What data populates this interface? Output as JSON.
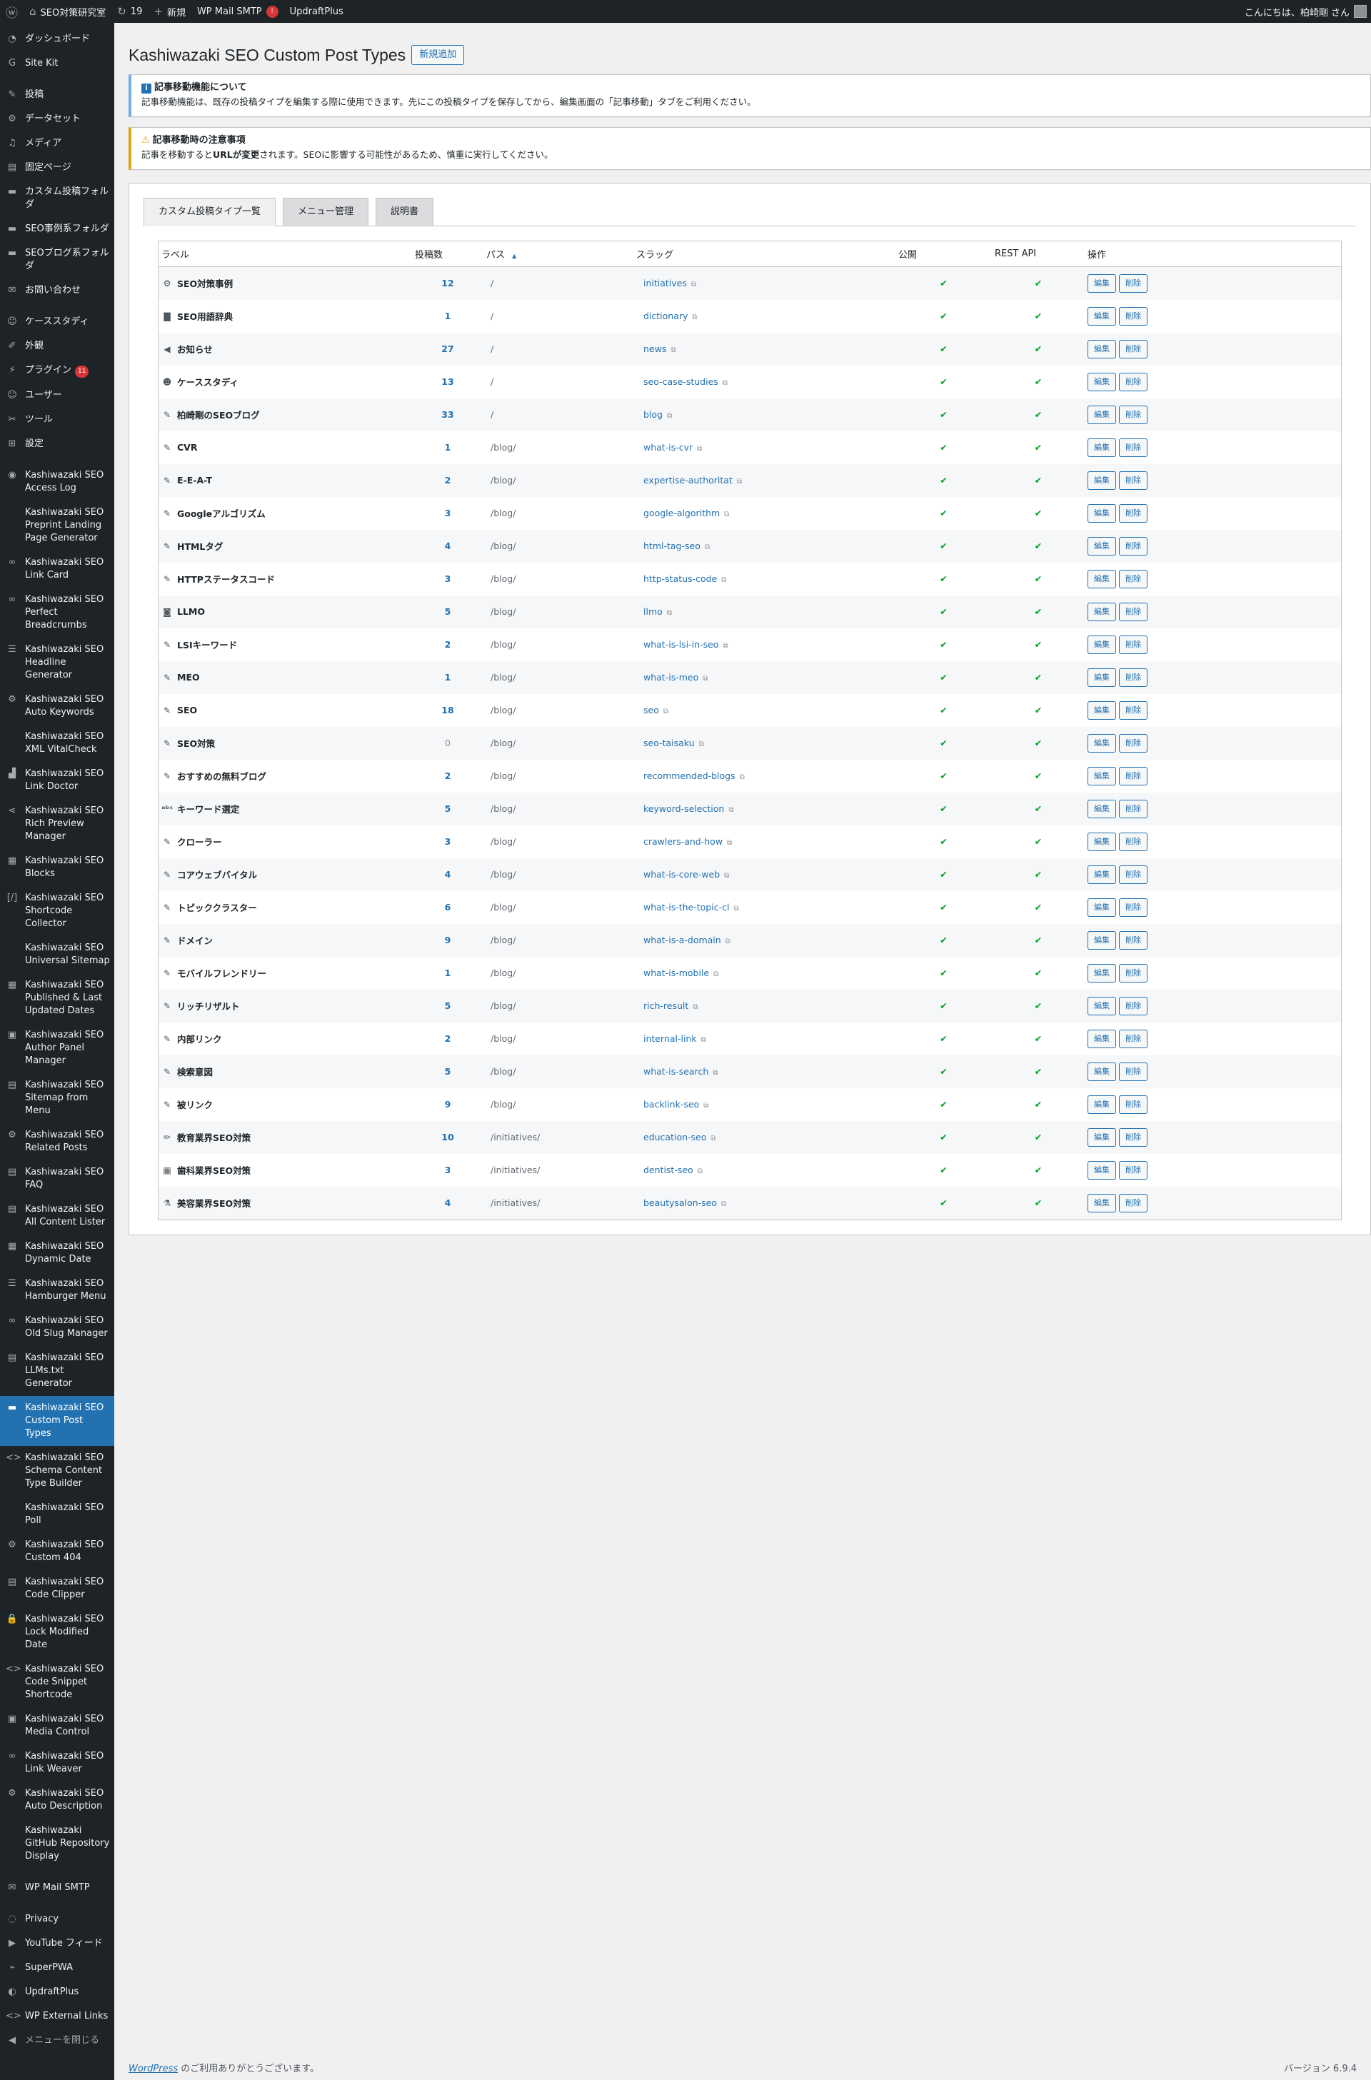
{
  "adminbar": {
    "site_name": "SEO対策研究室",
    "updates_count": "19",
    "new_label": "新規",
    "smtp_label": "WP Mail SMTP",
    "smtp_badge": "!",
    "updraft_label": "UpdraftPlus",
    "greeting": "こんにちは、柏崎剛 さん"
  },
  "sidebar": {
    "items": [
      {
        "label": "ダッシュボード",
        "icon": "dashboard-icon",
        "glyph": "◔"
      },
      {
        "label": "Site Kit",
        "icon": "sitekit-icon",
        "glyph": "G"
      },
      {
        "label": "投稿",
        "icon": "pin-icon",
        "glyph": "✎"
      },
      {
        "label": "データセット",
        "icon": "gear-icon",
        "glyph": "⚙"
      },
      {
        "label": "メディア",
        "icon": "media-icon",
        "glyph": "♫"
      },
      {
        "label": "固定ページ",
        "icon": "page-icon",
        "glyph": "▤"
      },
      {
        "label": "カスタム投稿フォルダ",
        "icon": "folder-icon",
        "glyph": "▬"
      },
      {
        "label": "SEO事例系フォルダ",
        "icon": "folder-icon",
        "glyph": "▬"
      },
      {
        "label": "SEOブログ系フォルダ",
        "icon": "folder-icon",
        "glyph": "▬"
      },
      {
        "label": "お問い合わせ",
        "icon": "mail-icon",
        "glyph": "✉"
      },
      {
        "label": "ケーススタディ",
        "icon": "user-icon",
        "glyph": "☺"
      },
      {
        "label": "外観",
        "icon": "brush-icon",
        "glyph": "✐"
      },
      {
        "label": "プラグイン",
        "icon": "plugin-icon",
        "glyph": "⚡",
        "badge": "11"
      },
      {
        "label": "ユーザー",
        "icon": "user-icon",
        "glyph": "☺"
      },
      {
        "label": "ツール",
        "icon": "wrench-icon",
        "glyph": "✂"
      },
      {
        "label": "設定",
        "icon": "settings-icon",
        "glyph": "⊞"
      },
      {
        "label": "Kashiwazaki SEO Access Log",
        "icon": "eye-icon",
        "glyph": "◉"
      },
      {
        "label": "Kashiwazaki SEO Preprint Landing Page Generator",
        "icon": "doc-icon",
        "glyph": ""
      },
      {
        "label": "Kashiwazaki SEO Link Card",
        "icon": "link-icon",
        "glyph": "∞"
      },
      {
        "label": "Kashiwazaki SEO Perfect Breadcrumbs",
        "icon": "link-icon",
        "glyph": "∞"
      },
      {
        "label": "Kashiwazaki SEO Headline Generator",
        "icon": "list-icon",
        "glyph": "☰"
      },
      {
        "label": "Kashiwazaki SEO Auto Keywords",
        "icon": "gear-icon",
        "glyph": "⚙"
      },
      {
        "label": "Kashiwazaki SEO XML VitalCheck",
        "icon": "doc-icon",
        "glyph": ""
      },
      {
        "label": "Kashiwazaki SEO Link Doctor",
        "icon": "chart-icon",
        "glyph": "▟"
      },
      {
        "label": "Kashiwazaki SEO Rich Preview Manager",
        "icon": "share-icon",
        "glyph": "⋖"
      },
      {
        "label": "Kashiwazaki SEO Blocks",
        "icon": "blocks-icon",
        "glyph": "▦"
      },
      {
        "label": "Kashiwazaki SEO Shortcode Collector",
        "icon": "shortcode-icon",
        "glyph": "[/]"
      },
      {
        "label": "Kashiwazaki SEO Universal Sitemap",
        "icon": "doc-icon",
        "glyph": ""
      },
      {
        "label": "Kashiwazaki SEO Published & Last Updated Dates",
        "icon": "calendar-icon",
        "glyph": "▦"
      },
      {
        "label": "Kashiwazaki SEO Author Panel Manager",
        "icon": "id-icon",
        "glyph": "▣"
      },
      {
        "label": "Kashiwazaki SEO Sitemap from Menu",
        "icon": "list-icon",
        "glyph": "▤"
      },
      {
        "label": "Kashiwazaki SEO Related Posts",
        "icon": "gear-icon",
        "glyph": "⚙"
      },
      {
        "label": "Kashiwazaki SEO FAQ",
        "icon": "faq-icon",
        "glyph": "▤"
      },
      {
        "label": "Kashiwazaki SEO All Content Lister",
        "icon": "list-icon",
        "glyph": "▤"
      },
      {
        "label": "Kashiwazaki SEO Dynamic Date",
        "icon": "calendar-icon",
        "glyph": "▦"
      },
      {
        "label": "Kashiwazaki SEO Hamburger Menu",
        "icon": "menu-icon",
        "glyph": "☰"
      },
      {
        "label": "Kashiwazaki SEO Old Slug Manager",
        "icon": "link-icon",
        "glyph": "∞"
      },
      {
        "label": "Kashiwazaki SEO LLMs.txt Generator",
        "icon": "doc-icon",
        "glyph": "▤"
      },
      {
        "label": "Kashiwazaki SEO Custom Post Types",
        "icon": "archive-icon",
        "glyph": "▬",
        "active": true
      },
      {
        "label": "Kashiwazaki SEO Schema Content Type Builder",
        "icon": "code-icon",
        "glyph": "<>"
      },
      {
        "label": "Kashiwazaki SEO Poll",
        "icon": "doc-icon",
        "glyph": ""
      },
      {
        "label": "Kashiwazaki SEO Custom 404",
        "icon": "gear-icon",
        "glyph": "⚙"
      },
      {
        "label": "Kashiwazaki SEO Code Clipper",
        "icon": "clipboard-icon",
        "glyph": "▤"
      },
      {
        "label": "Kashiwazaki SEO Lock Modified Date",
        "icon": "lock-icon",
        "glyph": "🔒"
      },
      {
        "label": "Kashiwazaki SEO Code Snippet Shortcode",
        "icon": "code-icon",
        "glyph": "<>"
      },
      {
        "label": "Kashiwazaki SEO Media Control",
        "icon": "image-icon",
        "glyph": "▣"
      },
      {
        "label": "Kashiwazaki SEO Link Weaver",
        "icon": "link-icon",
        "glyph": "∞"
      },
      {
        "label": "Kashiwazaki SEO Auto Description",
        "icon": "gear-icon",
        "glyph": "⚙"
      },
      {
        "label": "Kashiwazaki GitHub Repository Display",
        "icon": "doc-icon",
        "glyph": ""
      },
      {
        "label": "WP Mail SMTP",
        "icon": "smtp-icon",
        "glyph": "✉"
      },
      {
        "label": "Privacy",
        "icon": "privacy-icon",
        "glyph": "◌"
      },
      {
        "label": "YouTube フィード",
        "icon": "youtube-icon",
        "glyph": "▶"
      },
      {
        "label": "SuperPWA",
        "icon": "pwa-icon",
        "glyph": "⌁"
      },
      {
        "label": "UpdraftPlus",
        "icon": "updraft-icon",
        "glyph": "◐"
      },
      {
        "label": "WP External Links",
        "icon": "external-links-icon",
        "glyph": "<>"
      },
      {
        "label": "メニューを閉じる",
        "icon": "collapse-icon",
        "glyph": "◀",
        "collapse": true
      }
    ]
  },
  "page": {
    "title": "Kashiwazaki SEO Custom Post Types",
    "add_new": "新規追加"
  },
  "notices": {
    "info_title": "記事移動機能について",
    "info_text": "記事移動機能は、既存の投稿タイプを編集する際に使用できます。先にこの投稿タイプを保存してから、編集画面の「記事移動」タブをご利用ください。",
    "warn_title": "記事移動時の注意事項",
    "warn_text_pre": "記事を移動すると",
    "warn_text_bold": "URLが変更",
    "warn_text_post": "されます。SEOに影響する可能性があるため、慎重に実行してください。"
  },
  "tabs": [
    "カスタム投稿タイプ一覧",
    "メニュー管理",
    "説明書"
  ],
  "table": {
    "headers": {
      "label": "ラベル",
      "count": "投稿数",
      "path": "パス",
      "sort_indicator": "▲",
      "slug": "スラッグ",
      "public": "公開",
      "rest": "REST API",
      "actions": "操作"
    },
    "edit_label": "編集",
    "delete_label": "削除",
    "check": "✔",
    "rows": [
      {
        "label": "SEO対策事例",
        "count": "12",
        "path": "/",
        "slug": "initiatives",
        "icon": "grid-icon",
        "glyph": "⚙"
      },
      {
        "label": "SEO用語辞典",
        "count": "1",
        "path": "/",
        "slug": "dictionary",
        "icon": "book-icon",
        "glyph": "▇"
      },
      {
        "label": "お知らせ",
        "count": "27",
        "path": "/",
        "slug": "news",
        "icon": "megaphone-icon",
        "glyph": "◀"
      },
      {
        "label": "ケーススタディ",
        "count": "13",
        "path": "/",
        "slug": "seo-case-studies",
        "icon": "user-icon",
        "glyph": "☻"
      },
      {
        "label": "柏崎剛のSEOブログ",
        "count": "33",
        "path": "/",
        "slug": "blog",
        "icon": "post-icon",
        "glyph": "✎"
      },
      {
        "label": "CVR",
        "count": "1",
        "path": "/blog/",
        "slug": "what-is-cvr",
        "icon": "post-icon",
        "glyph": "✎"
      },
      {
        "label": "E-E-A-T",
        "count": "2",
        "path": "/blog/",
        "slug": "expertise-authoritat",
        "icon": "post-icon",
        "glyph": "✎"
      },
      {
        "label": "Googleアルゴリズム",
        "count": "3",
        "path": "/blog/",
        "slug": "google-algorithm",
        "icon": "post-icon",
        "glyph": "✎"
      },
      {
        "label": "HTMLタグ",
        "count": "4",
        "path": "/blog/",
        "slug": "html-tag-seo",
        "icon": "post-icon",
        "glyph": "✎"
      },
      {
        "label": "HTTPステータスコード",
        "count": "3",
        "path": "/blog/",
        "slug": "http-status-code",
        "icon": "post-icon",
        "glyph": "✎"
      },
      {
        "label": "LLMO",
        "count": "5",
        "path": "/blog/",
        "slug": "llmo",
        "icon": "robot-icon",
        "glyph": "◙"
      },
      {
        "label": "LSIキーワード",
        "count": "2",
        "path": "/blog/",
        "slug": "what-is-lsi-in-seo",
        "icon": "post-icon",
        "glyph": "✎"
      },
      {
        "label": "MEO",
        "count": "1",
        "path": "/blog/",
        "slug": "what-is-meo",
        "icon": "post-icon",
        "glyph": "✎"
      },
      {
        "label": "SEO",
        "count": "18",
        "path": "/blog/",
        "slug": "seo",
        "icon": "post-icon",
        "glyph": "✎"
      },
      {
        "label": "SEO対策",
        "count": "0",
        "path": "/blog/",
        "slug": "seo-taisaku",
        "icon": "post-icon",
        "glyph": "✎"
      },
      {
        "label": "おすすめの無料ブログ",
        "count": "2",
        "path": "/blog/",
        "slug": "recommended-blogs",
        "icon": "post-icon",
        "glyph": "✎"
      },
      {
        "label": "キーワード選定",
        "count": "5",
        "path": "/blog/",
        "slug": "keyword-selection",
        "icon": "abc-icon",
        "glyph": "ᵃᵇᶜ"
      },
      {
        "label": "クローラー",
        "count": "3",
        "path": "/blog/",
        "slug": "crawlers-and-how",
        "icon": "post-icon",
        "glyph": "✎"
      },
      {
        "label": "コアウェブバイタル",
        "count": "4",
        "path": "/blog/",
        "slug": "what-is-core-web",
        "icon": "post-icon",
        "glyph": "✎"
      },
      {
        "label": "トピッククラスター",
        "count": "6",
        "path": "/blog/",
        "slug": "what-is-the-topic-cl",
        "icon": "post-icon",
        "glyph": "✎"
      },
      {
        "label": "ドメイン",
        "count": "9",
        "path": "/blog/",
        "slug": "what-is-a-domain",
        "icon": "post-icon",
        "glyph": "✎"
      },
      {
        "label": "モバイルフレンドリー",
        "count": "1",
        "path": "/blog/",
        "slug": "what-is-mobile",
        "icon": "post-icon",
        "glyph": "✎"
      },
      {
        "label": "リッチリザルト",
        "count": "5",
        "path": "/blog/",
        "slug": "rich-result",
        "icon": "post-icon",
        "glyph": "✎"
      },
      {
        "label": "内部リンク",
        "count": "2",
        "path": "/blog/",
        "slug": "internal-link",
        "icon": "post-icon",
        "glyph": "✎"
      },
      {
        "label": "検索意図",
        "count": "5",
        "path": "/blog/",
        "slug": "what-is-search",
        "icon": "post-icon",
        "glyph": "✎"
      },
      {
        "label": "被リンク",
        "count": "9",
        "path": "/blog/",
        "slug": "backlink-seo",
        "icon": "post-icon",
        "glyph": "✎"
      },
      {
        "label": "教育業界SEO対策",
        "count": "10",
        "path": "/initiatives/",
        "slug": "education-seo",
        "icon": "pencil-icon",
        "glyph": "✏"
      },
      {
        "label": "歯科業界SEO対策",
        "count": "3",
        "path": "/initiatives/",
        "slug": "dentist-seo",
        "icon": "calendar-icon",
        "glyph": "▦"
      },
      {
        "label": "美容業界SEO対策",
        "count": "4",
        "path": "/initiatives/",
        "slug": "beautysalon-seo",
        "icon": "flask-icon",
        "glyph": "⚗"
      }
    ]
  },
  "footer": {
    "wp_link": "WordPress",
    "thanks": " のご利用ありがとうございます。",
    "version": "バージョン 6.9.4"
  }
}
